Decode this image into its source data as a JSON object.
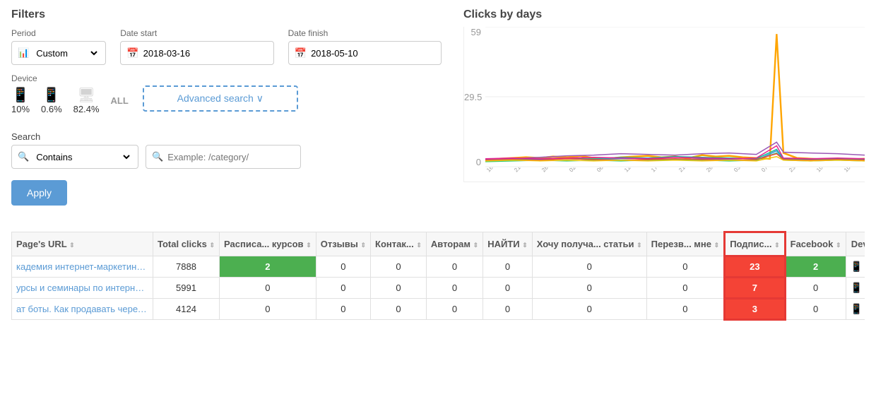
{
  "page": {
    "filters_title": "Filters",
    "period_label": "Period",
    "period_value": "Custom",
    "date_start_label": "Date start",
    "date_start_value": "2018-03-16",
    "date_finish_label": "Date finish",
    "date_finish_value": "2018-05-10",
    "device_label": "Device",
    "device_mobile_pct": "10%",
    "device_tablet_pct": "0.6%",
    "device_desktop_pct": "82.4%",
    "device_all": "ALL",
    "advanced_search_label": "Advanced search ∨",
    "search_label": "Search",
    "search_type_value": "Contains",
    "search_placeholder": "Example: /category/",
    "apply_label": "Apply",
    "chart_title": "Clicks by days",
    "chart_y_max": "59",
    "chart_y_mid": "29.5",
    "chart_y_min": "0",
    "chart_x_labels": [
      "16.03.18",
      "21.03.18",
      "28.03.18",
      "02.04.18",
      "06.04.18",
      "12.04.18",
      "17.04.18",
      "21.04.18",
      "26.04.18",
      "03.05.18",
      "07.05.18",
      "23.03.18",
      "10.04.18",
      "10.05.18"
    ]
  },
  "table": {
    "headers": {
      "url": "Page's URL",
      "total_clicks": "Total clicks",
      "raspisanie": "Расписа... курсов",
      "otzyvy": "Отзывы",
      "kontakty": "Контак...",
      "avtoram": "Авторам",
      "naiti": "НАЙТИ",
      "hochu": "Хочу получа... статьи",
      "perezv": "Перезв... мне",
      "podpis": "Подпис...",
      "facebook": "Facebook",
      "device": "Device"
    },
    "rows": [
      {
        "url": "кадемия интернет-маркетинга WebPro...",
        "total_clicks": "7888",
        "raspisanie": "2",
        "otzyvy": "0",
        "kontakty": "0",
        "avtoram": "0",
        "naiti": "0",
        "hochu": "0",
        "perezv": "0",
        "podpis": "23",
        "facebook": "2",
        "raspisanie_green": true,
        "podpis_red": true,
        "facebook_green": true
      },
      {
        "url": "урсы и семинары по интернет-маркети...",
        "total_clicks": "5991",
        "raspisanie": "0",
        "otzyvy": "0",
        "kontakty": "0",
        "avtoram": "0",
        "naiti": "0",
        "hochu": "0",
        "perezv": "0",
        "podpis": "7",
        "facebook": "0",
        "raspisanie_green": false,
        "podpis_red": true,
        "facebook_green": false
      },
      {
        "url": "ат боты. Как продавать через мессендж...",
        "total_clicks": "4124",
        "raspisanie": "0",
        "otzyvy": "0",
        "kontakty": "0",
        "avtoram": "0",
        "naiti": "0",
        "hochu": "0",
        "perezv": "0",
        "podpis": "3",
        "facebook": "0",
        "raspisanie_green": false,
        "podpis_red": true,
        "facebook_green": false
      }
    ]
  }
}
